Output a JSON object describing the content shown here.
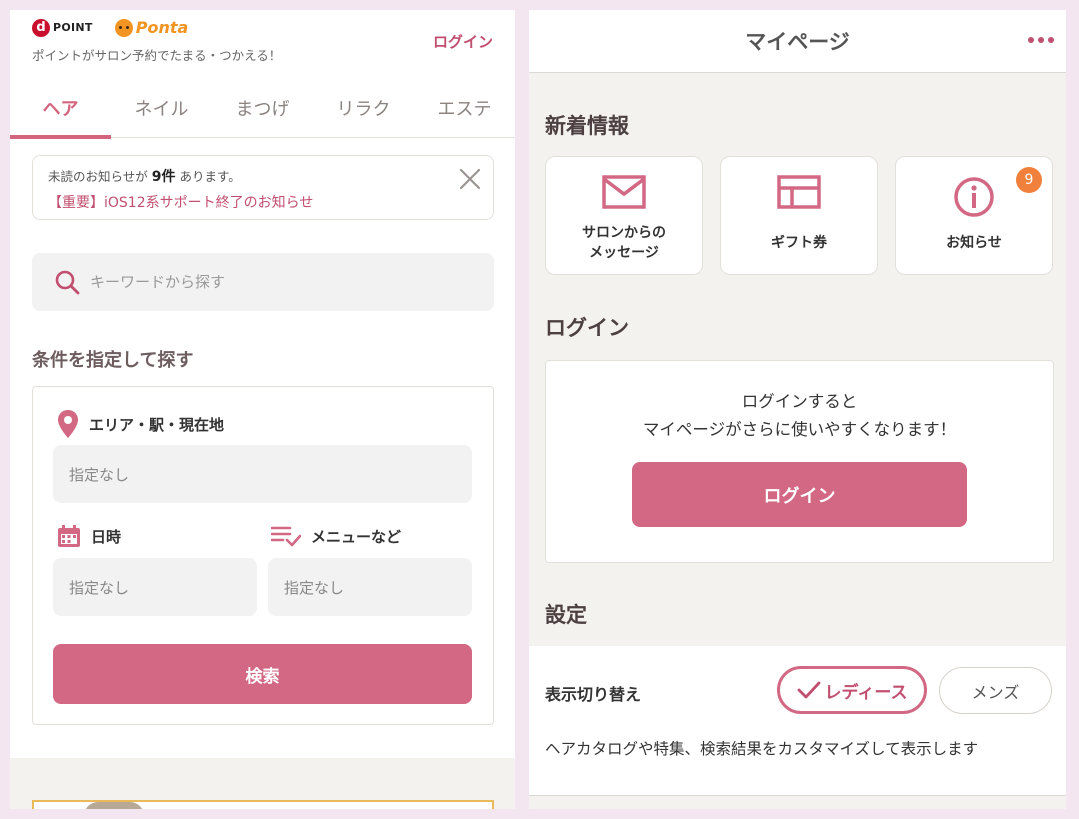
{
  "left": {
    "header": {
      "dpoint_mark": "d",
      "dpoint_label": "POINT",
      "ponta_label": "Ponta",
      "tagline": "ポイントがサロン予約でたまる・つかえる！",
      "login_link": "ログイン"
    },
    "tabs": [
      "ヘア",
      "ネイル",
      "まつげ",
      "リラク",
      "エステ"
    ],
    "active_tab": "ヘア",
    "notice": {
      "prefix": "未読のお知らせが ",
      "count": "9件",
      "suffix": " あります。",
      "link": "【重要】iOS12系サポート終了のお知らせ"
    },
    "search": {
      "placeholder": "キーワードから探す"
    },
    "conditions": {
      "title": "条件を指定して探す",
      "area_label": "エリア・駅・現在地",
      "area_value": "指定なし",
      "date_label": "日時",
      "date_value": "指定なし",
      "menu_label": "メニューなど",
      "menu_value": "指定なし",
      "search_button": "検索"
    }
  },
  "right": {
    "title": "マイページ",
    "news": {
      "title": "新着情報",
      "cards": [
        {
          "label": "サロンからの\nメッセージ",
          "icon": "envelope-icon"
        },
        {
          "label": "ギフト券",
          "icon": "gift-card-icon"
        },
        {
          "label": "お知らせ",
          "icon": "info-icon",
          "badge": "9"
        }
      ]
    },
    "login": {
      "title": "ログイン",
      "message_line1": "ログインすると",
      "message_line2": "マイページがさらに使いやすくなります！",
      "button": "ログイン"
    },
    "settings": {
      "title": "設定",
      "display_switch_label": "表示切り替え",
      "ladies": "レディース",
      "mens": "メンズ",
      "selected": "レディース",
      "description": "ヘアカタログや特集、検索結果をカスタマイズして表示します"
    }
  },
  "colors": {
    "accent": "#d26883",
    "accent_text": "#c14f6f",
    "badge": "#f0803c",
    "background": "#f3e6f1"
  }
}
